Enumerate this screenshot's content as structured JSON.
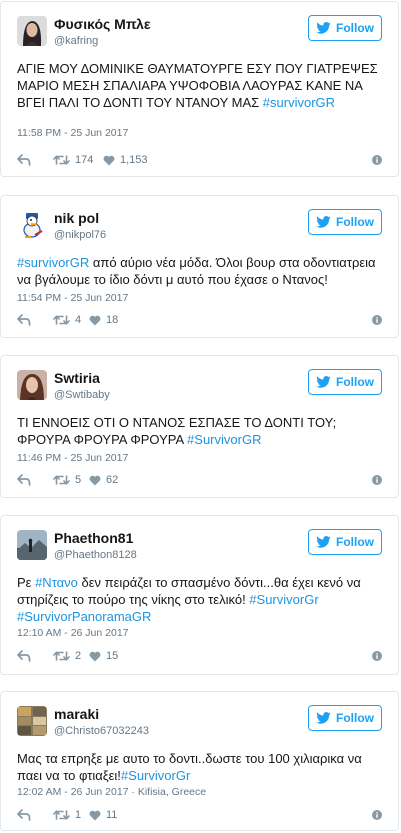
{
  "follow_label": "Follow",
  "colors": {
    "accent": "#1da1f2",
    "hashtag": "#1b95e0",
    "muted": "#657786",
    "border": "#e1e8ed"
  },
  "tweets": [
    {
      "name": "Φυσικός Μπλε",
      "handle": "@kafring",
      "avatar": "woman-dark-hair-avatar",
      "text_parts": [
        {
          "t": "ΑΓΙΕ ΜΟΥ ΔΟΜΙΝΙΚΕ ΘΑΥΜΑΤΟΥΡΓΕ ΕΣΥ ΠΟΥ ΓΙΑΤΡΕΨΕΣ ΜΑΡΙΟ ΜΕΣΗ ΣΠΑΛΙΑΡΑ ΥΨΟΦΟΒΙΑ ΛΑΟΥΡΑΣ ΚΑΝΕ ΝΑ ΒΓΕΙ ΠΑΛΙ ΤΟ ΔΟΝΤΙ ΤΟΥ ΝΤΑΝΟΥ ΜΑΣ "
        },
        {
          "t": "#survivorGR",
          "tag": true
        }
      ],
      "timestamp": "11:58 PM - 25 Jun 2017",
      "retweets": "174",
      "likes": "1,153"
    },
    {
      "name": "nik pol",
      "handle": "@nikpol76",
      "avatar": "cartoon-duck-avatar",
      "text_parts": [
        {
          "t": "#survivorGR",
          "tag": true
        },
        {
          "t": " από αύριο νέα μόδα. Όλοι βουρ στα οδοντιατρεια να βγάλουμε το ίδιο δόντι μ αυτό που έχασε ο Ντανος!"
        }
      ],
      "timestamp": "11:54 PM - 25 Jun 2017",
      "retweets": "4",
      "likes": "18"
    },
    {
      "name": "Swtiria",
      "handle": "@Swtibaby",
      "avatar": "woman-portrait-avatar",
      "text_parts": [
        {
          "t": "ΤΙ ΕΝΝΟΕΙΣ ΟΤΙ Ο ΝΤΑΝΟΣ ΕΣΠΑΣΕ ΤΟ ΔΟΝΤΙ ΤΟΥ; ΦΡΟΥΡΑ ΦΡΟΥΡΑ ΦΡΟΥΡΑ "
        },
        {
          "t": "#SurvivorGR",
          "tag": true
        }
      ],
      "timestamp": "11:46 PM - 25 Jun 2017",
      "retweets": "5",
      "likes": "62"
    },
    {
      "name": "Phaethon81",
      "handle": "@Phaethon8128",
      "avatar": "landscape-silhouette-avatar",
      "text_parts": [
        {
          "t": "Ρε "
        },
        {
          "t": "#Ντανο",
          "tag": true
        },
        {
          "t": " δεν πειράζει το σπασμένο δόντι...θα έχει κενό να στηρίζεις το πούρο της νίκης στο τελικό! "
        },
        {
          "t": "#SurvivorGr",
          "tag": true
        },
        {
          "t": " "
        },
        {
          "t": "#SurvivorPanoramaGR",
          "tag": true
        }
      ],
      "timestamp": "12:10 AM - 26 Jun 2017",
      "retweets": "2",
      "likes": "15"
    },
    {
      "name": "maraki",
      "handle": "@Christo67032243",
      "avatar": "collage-avatar",
      "text_parts": [
        {
          "t": "Μας τα επρηξε με αυτο το δοντι..δωστε του 100 χιλιαρικα να παει να το φτιαξει!"
        },
        {
          "t": "#SurvivorGr",
          "tag": true
        }
      ],
      "timestamp": "12:02 AM - 26 Jun 2017 · Kifisia, Greece",
      "retweets": "1",
      "likes": "11"
    }
  ]
}
